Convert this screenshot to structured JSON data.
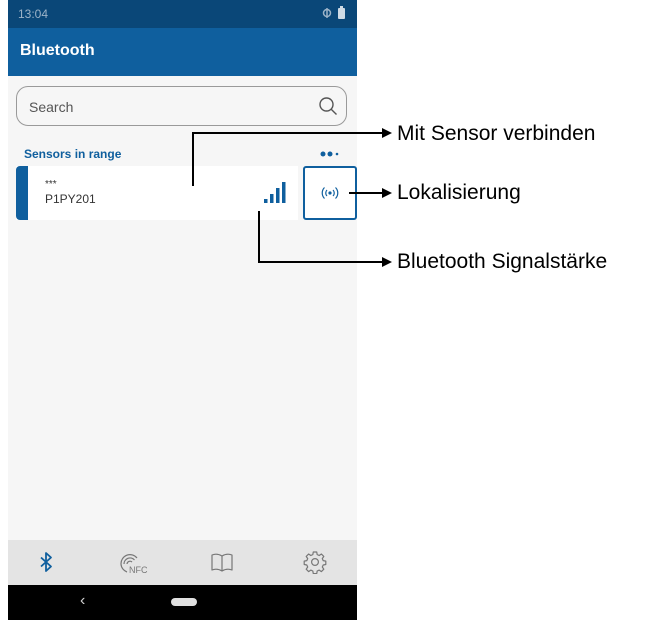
{
  "status_bar": {
    "time": "13:04"
  },
  "app_bar": {
    "title": "Bluetooth"
  },
  "search": {
    "placeholder": "Search"
  },
  "sensors": {
    "header": "Sensors in range",
    "items": [
      {
        "masked_id": "***",
        "name": "P1PY201",
        "signal_bars": 4
      }
    ]
  },
  "bottom_nav": {
    "items": [
      "bluetooth-icon",
      "nfc-icon",
      "book-icon",
      "settings-icon"
    ],
    "nfc_label": "NFC"
  },
  "annotations": {
    "connect": "Mit Sensor verbinden",
    "locate": "Lokalisierung",
    "signal": "Bluetooth Signalstärke"
  },
  "colors": {
    "primary": "#0f5f9e",
    "status_bar": "#0a4778",
    "background": "#f6f6f6",
    "nav": "#e4e4e4"
  }
}
